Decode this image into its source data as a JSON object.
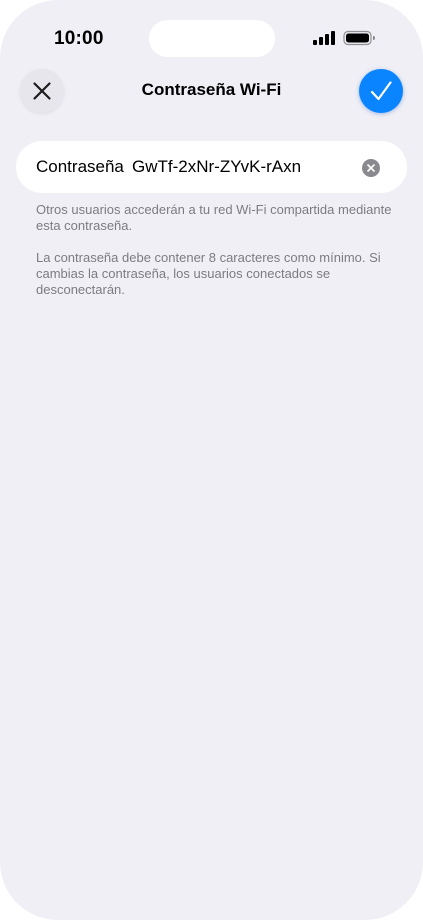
{
  "status_bar": {
    "time": "10:00",
    "icons": [
      "cellular-signal-icon",
      "battery-icon"
    ]
  },
  "nav": {
    "title": "Contraseña Wi-Fi",
    "close_icon": "close-icon",
    "done_icon": "checkmark-icon"
  },
  "password_field": {
    "label": "Contraseña",
    "value": "GwTf-2xNr-ZYvK-rAxn",
    "clear_icon": "clear-icon"
  },
  "notes": {
    "sharing": "Otros usuarios accederán a tu red Wi-Fi compartida mediante esta contraseña.",
    "requirements": "La contraseña debe contener 8 caracteres como mínimo. Si cambias la contraseña, los usuarios conectados se desconectarán."
  },
  "colors": {
    "background": "#f0eff5",
    "accent": "#0a84ff",
    "secondary_text": "#7c7c80"
  }
}
